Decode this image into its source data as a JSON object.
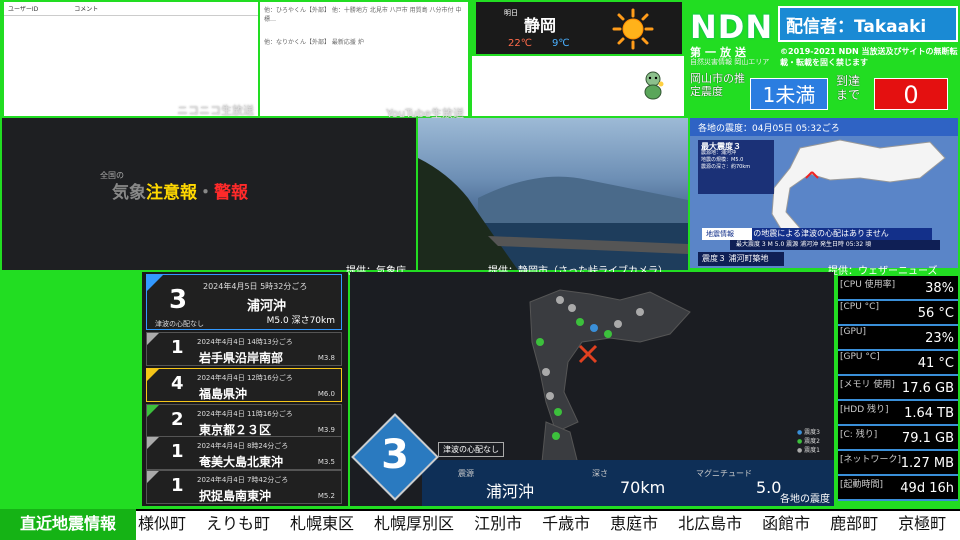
{
  "nico": {
    "col_user": "ユーザーID",
    "col_comment": "コメント",
    "label": "ニコニコ生放送"
  },
  "yt": {
    "line1": "他：ひろやくん【外部】  他：十勝地方 北見市 八戸市 用質島 八分市付 中標…",
    "line2": "他：なりかくん【外部】  最新応援   炉",
    "label": "YouTube生放送"
  },
  "weather": {
    "day": "明日",
    "city": "静岡",
    "high": "22℃",
    "low": "9℃",
    "icon": "sun-icon"
  },
  "ndn": {
    "logo": "NDN",
    "caster": "配信者：Takaaki",
    "ippou": "第一放送",
    "ippou_sub": "自然災害情報 岡山エリア",
    "copyright": "©2019-2021 NDN 当放送及びサイトの無断転載・転載を固く禁じます",
    "okayama_label": "岡山市の推定震度",
    "okayama_value": "1未満",
    "arrival_label": "到達まで",
    "arrival_value": "0"
  },
  "jma": {
    "small": "全国の",
    "w1": "気象",
    "w2": "注意報",
    "w3": "・",
    "w4": "警報",
    "source": "提供：気象庁"
  },
  "cam": {
    "source": "提供：静岡市（さった峠ライブカメラ）"
  },
  "wn": {
    "header": "各地の震度：04月05日 05:32ごろ",
    "max_label": "最大震度３",
    "epicenter": "震源地：浦河沖",
    "mag": "地震の規模：M5.0",
    "depth": "震源の深さ：約70km",
    "notice_left": "地震情報",
    "notice": "この地震による津波の心配はありません",
    "strip": "最大震度 3  M 5.0  震源 浦河沖  発生日時 05:32 頃",
    "place": "震度３ 浦河町築地",
    "source": "提供：ウェザーニューズ"
  },
  "quakes": {
    "first": {
      "intensity": "3",
      "datetime": "2024年4月5日 5時32分ごろ",
      "name": "浦河沖",
      "tsunami": "津波の心配なし",
      "mag": "M5.0 深さ70km"
    },
    "items": [
      {
        "intensity": "1",
        "datetime": "2024年4月4日 14時13分ごろ",
        "name": "岩手県沿岸南部",
        "mag": "M3.8",
        "color": "#aaaaaa"
      },
      {
        "intensity": "4",
        "datetime": "2024年4月4日 12時16分ごろ",
        "name": "福島県沖",
        "mag": "M6.0",
        "color": "#f5c518"
      },
      {
        "intensity": "2",
        "datetime": "2024年4月4日 11時16分ごろ",
        "name": "東京都２３区",
        "mag": "M3.9",
        "color": "#3cc03c"
      },
      {
        "intensity": "1",
        "datetime": "2024年4月4日 8時24分ごろ",
        "name": "奄美大島北東沖",
        "mag": "M3.5",
        "color": "#aaaaaa"
      },
      {
        "intensity": "1",
        "datetime": "2024年4月4日 7時42分ごろ",
        "name": "択捉島南東沖",
        "mag": "M5.2",
        "color": "#aaaaaa"
      }
    ]
  },
  "mainmap": {
    "intensity": "3",
    "tsunami": "津波の心配なし",
    "epi_label": "震源",
    "epi_value": "浦河沖",
    "depth_label": "深さ",
    "depth_value": "70km",
    "mag_label": "マグニチュード",
    "mag_value": "5.0",
    "legend": [
      "震度3",
      "震度2",
      "震度1"
    ],
    "kakuchi": "各地の震度"
  },
  "sys": [
    {
      "label": "[CPU 使用率]",
      "value": "38%"
    },
    {
      "label": "[CPU °C]",
      "value": "56 °C"
    },
    {
      "label": "[GPU]",
      "value": "23%"
    },
    {
      "label": "[GPU °C]",
      "value": "41 °C"
    },
    {
      "label": "[メモリ 使用]",
      "value": "17.6 GB"
    },
    {
      "label": "[HDD 残り]",
      "value": "1.64 TB"
    },
    {
      "label": "[C: 残り]",
      "value": "79.1 GB"
    },
    {
      "label": "[ネットワーク]",
      "value": "1.27 MB"
    },
    {
      "label": "[起動時間]",
      "value": "49d 16h"
    }
  ],
  "ticker": {
    "label": "直近地震情報",
    "items": [
      "様似町",
      "えりも町",
      "札幌東区",
      "札幌厚別区",
      "江別市",
      "千歳市",
      "恵庭市",
      "北広島市",
      "函館市",
      "鹿部町",
      "京極町"
    ]
  }
}
